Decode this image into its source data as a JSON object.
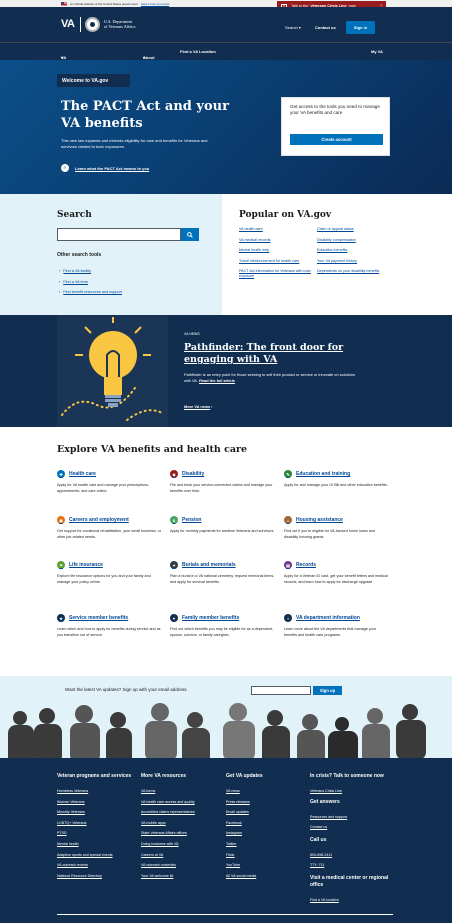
{
  "gov_banner": {
    "text": "An official website of the United States government",
    "link": "Here's how you know"
  },
  "crisis": {
    "prefix": "Talk to the",
    "name": "Veterans Crisis Line",
    "suffix": "now"
  },
  "header": {
    "logo": "VA",
    "dept_line1": "U.S. Department",
    "dept_line2": "of Veterans Affairs",
    "search": "Search",
    "contact": "Contact us",
    "signin": "Sign in"
  },
  "nav": {
    "benefits": "VA Benefits and Health Care",
    "about": "About VA",
    "find": "Find a VA Location",
    "myva": "My VA"
  },
  "hero": {
    "tag": "Welcome to VA.gov",
    "title": "The PACT Act and your VA benefits",
    "desc": "This new law expands and extends eligibility for care and benefits for Veterans and survivors related to toxic exposures.",
    "link": "Learn what the PACT Act means to you",
    "card_text": "Get access to the tools you need to manage your VA benefits and care",
    "card_button": "Create account"
  },
  "search": {
    "heading": "Search",
    "other_heading": "Other search tools",
    "other_links": [
      "Find a VA facility",
      "Find a VA form",
      "Find benefit resources and support"
    ]
  },
  "popular": {
    "heading": "Popular on VA.gov",
    "col1": [
      "VA health care",
      "VA medical records",
      "Mental health help",
      "Travel reimbursement for health care",
      "PACT Act information for Veterans with toxic exposure"
    ],
    "col2": [
      "Claim or appeal status",
      "Disability compensation",
      "Education benefits",
      "Your VA payment history",
      "Dependents on your disability benefits"
    ]
  },
  "news": {
    "tag": "VA NEWS",
    "title": "Pathfinder: The front door for engaging with VA",
    "desc": "Pathfinder is an entry point for those seeking to sell their product or service or innovate on solutions with VA.",
    "read_link": "Read the full article",
    "more": "More VA news"
  },
  "explore": {
    "heading": "Explore VA benefits and health care",
    "items": [
      {
        "title": "Health care",
        "desc": "Apply for VA health care and manage your prescriptions, appointments, and care online.",
        "color": "#0071bb"
      },
      {
        "title": "Disability",
        "desc": "File and track your service-connected claims and manage your benefits over time.",
        "color": "#981b1e"
      },
      {
        "title": "Education and training",
        "desc": "Apply for and manage your GI Bill and other education benefits.",
        "color": "#2e8540"
      },
      {
        "title": "Careers and employment",
        "desc": "Get support for vocational rehabilitation, your small business, or other job-related needs.",
        "color": "#e66f0e"
      },
      {
        "title": "Pension",
        "desc": "Apply for monthly payments for wartime Veterans and survivors.",
        "color": "#4aa564"
      },
      {
        "title": "Housing assistance",
        "desc": "Find out if you're eligible for VA-backed home loans and disability housing grants.",
        "color": "#a0673c"
      },
      {
        "title": "Life insurance",
        "desc": "Explore life insurance options for you and your family and manage your policy online.",
        "color": "#5e9f2f"
      },
      {
        "title": "Burials and memorials",
        "desc": "Plan a burial in a VA national cemetery, request memorial items, and apply for survival benefits.",
        "color": "#323a45"
      },
      {
        "title": "Records",
        "desc": "Apply for a Veteran ID card, get your benefit letters and medical records, and learn how to apply for discharge upgrade.",
        "color": "#6c3d8f"
      },
      {
        "title": "Service member benefits",
        "desc": "Learn when and how to apply for benefits during service and as you transition out of service.",
        "color": "#112e51"
      },
      {
        "title": "Family member benefits",
        "desc": "Find out which benefits you may be eligible for as a dependent, spouse, survivor, or family caregiver.",
        "color": "#112e51"
      },
      {
        "title": "VA department information",
        "desc": "Learn more about the VA departments that manage your benefits and health care programs.",
        "color": "#112e51"
      }
    ]
  },
  "email": {
    "text": "Want the latest VA updates? Sign up with your email address.",
    "button": "Sign up"
  },
  "footer": {
    "col1": {
      "heading": "Veteran programs and services",
      "links": [
        "Homeless Veterans",
        "Women Veterans",
        "Minority Veterans",
        "LGBTQ+ Veterans",
        "PTSD",
        "Mental health",
        "Adaptive sports and special events",
        "VA outreach events",
        "National Resource Directory"
      ]
    },
    "col2": {
      "heading": "More VA resources",
      "links": [
        "VA forms",
        "VA health care access and quality",
        "Accredited claims representatives",
        "VA mobile apps",
        "State Veterans Affairs offices",
        "Doing business with VA",
        "Careers at VA",
        "VA outreach materials",
        "Your VA welcome kit"
      ]
    },
    "col3": {
      "heading": "Get VA updates",
      "links": [
        "VA news",
        "Press releases",
        "Email updates",
        "Facebook",
        "Instagram",
        "Twitter",
        "Flickr",
        "YouTube",
        "All VA social media"
      ]
    },
    "col4": {
      "heading": "In crisis? Talk to someone now",
      "crisis_link": "Veterans Crisis Line",
      "answers_heading": "Get answers",
      "answers_links": [
        "Resources and support",
        "Contact us"
      ],
      "call_heading": "Call us",
      "call_links": [
        "800-698-2411",
        "TTY: 711"
      ],
      "visit_heading": "Visit a medical center or regional office",
      "visit_link": "Find a VA location"
    }
  }
}
